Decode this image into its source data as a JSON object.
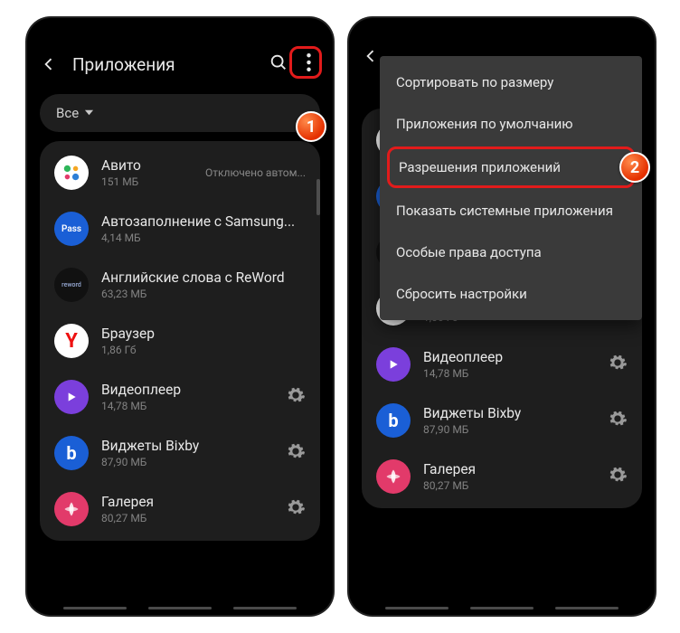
{
  "header": {
    "title": "Приложения"
  },
  "filter": {
    "label": "Все"
  },
  "apps": [
    {
      "name": "Авито",
      "size": "151 МБ",
      "status": "Отключено автом...",
      "iconBg": "#ffffff",
      "iconFg": "#000"
    },
    {
      "name": "Автозаполнение с Samsung...",
      "size": "4,14 МБ",
      "iconBg": "#1a5fd6",
      "iconFg": "#fff",
      "iconText": "Pass"
    },
    {
      "name": "Английские слова с ReWord",
      "size": "63,23 МБ",
      "iconBg": "#111",
      "iconFg": "#9aa",
      "iconText": "reword"
    },
    {
      "name": "Браузер",
      "size": "1,86 Гб",
      "iconBg": "#fff",
      "iconFg": "#e11",
      "iconText": "Y"
    },
    {
      "name": "Видеоплеер",
      "size": "14,78 МБ",
      "iconBg": "#7b3fdc",
      "iconFg": "#fff",
      "gear": true
    },
    {
      "name": "Виджеты Bixby",
      "size": "87,90 МБ",
      "iconBg": "#1a5fd6",
      "iconFg": "#fff",
      "iconText": "b",
      "gear": true
    },
    {
      "name": "Галерея",
      "size": "80,27 МБ",
      "iconBg": "#e23a6a",
      "iconFg": "#fff",
      "gear": true
    }
  ],
  "menu": [
    "Сортировать по размеру",
    "Приложения по умолчанию",
    "Разрешения приложений",
    "Показать системные приложения",
    "Особые права доступа",
    "Сбросить настройки"
  ],
  "annotations": {
    "step1": "1",
    "step2": "2"
  }
}
